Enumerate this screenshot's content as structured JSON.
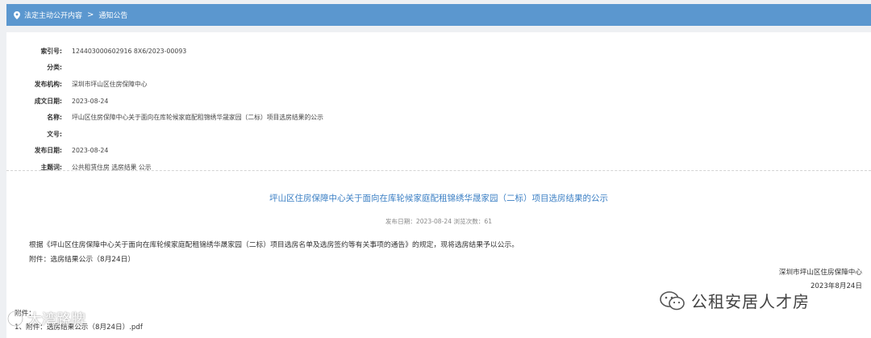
{
  "breadcrumb": {
    "item1": "法定主动公开内容",
    "separator": ">",
    "item2": "通知公告"
  },
  "meta": [
    {
      "label": "索引号:",
      "value": "124403000602916 8X6/2023-00093"
    },
    {
      "label": "分类:",
      "value": ""
    },
    {
      "label": "发布机构:",
      "value": "深圳市坪山区住房保障中心"
    },
    {
      "label": "成文日期:",
      "value": "2023-08-24"
    },
    {
      "label": "名称:",
      "value": "坪山区住房保障中心关于面向在库轮候家庭配租锦绣华晟家园（二标）项目选房结果的公示"
    },
    {
      "label": "文号:",
      "value": ""
    },
    {
      "label": "发布日期:",
      "value": "2023-08-24"
    },
    {
      "label": "主题词:",
      "value": "公共租赁住房 选房结果 公示"
    }
  ],
  "article": {
    "title": "坪山区住房保障中心关于面向在库轮候家庭配租锦绣华晟家园（二标）项目选房结果的公示",
    "info": "发布日期：2023-08-24  浏览次数：61",
    "body": "根据《坪山区住房保障中心关于面向在库轮候家庭配租锦绣华晟家园（二标）项目选房名单及选房签约等有关事项的通告》的规定，现将选房结果予以公示。",
    "attachment": "附件：选房结果公示（8月24日）",
    "org": "深圳市坪山区住房保障中心",
    "date": "2023年8月24日",
    "attach_label": "附件：",
    "attach_item": "1、附件：选房结果公示（8月24日）.pdf"
  },
  "watermarks": {
    "right": "公租安居人才房",
    "left": "大湾路牌"
  },
  "colors": {
    "topbar": "#5b97cf",
    "title": "#3b7fc4"
  }
}
